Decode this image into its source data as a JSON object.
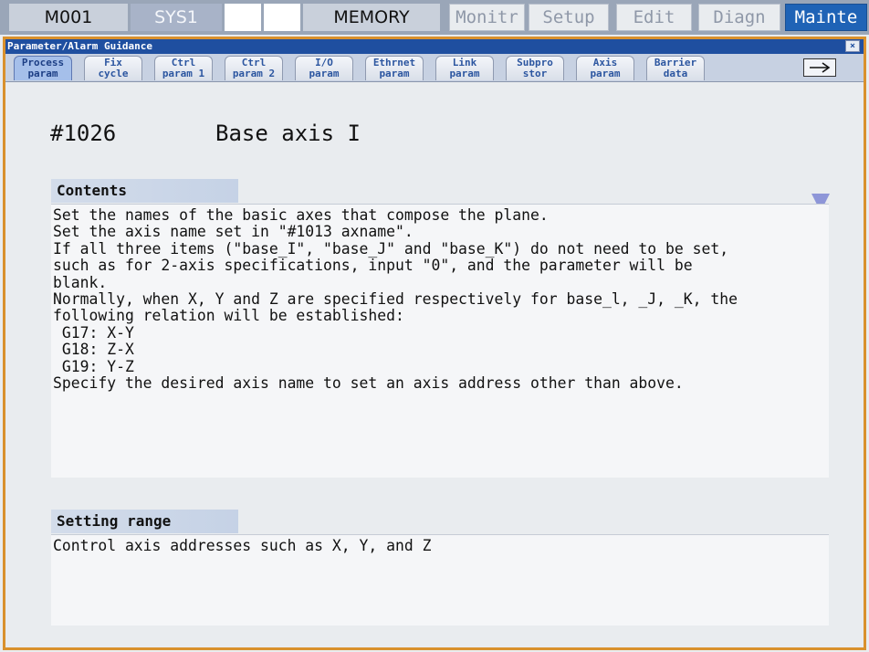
{
  "topbar": {
    "status": "M001",
    "system": "SYS1",
    "mode": "MEMORY",
    "menus": [
      "Monitr",
      "Setup",
      "Edit",
      "Diagn",
      "Mainte"
    ]
  },
  "window": {
    "title": "Parameter/Alarm Guidance",
    "close": "×"
  },
  "tabs": [
    {
      "line1": "Process",
      "line2": "param"
    },
    {
      "line1": "Fix",
      "line2": "cycle"
    },
    {
      "line1": "Ctrl",
      "line2": "param 1"
    },
    {
      "line1": "Ctrl",
      "line2": "param 2"
    },
    {
      "line1": "I/O",
      "line2": "param"
    },
    {
      "line1": "Ethrnet",
      "line2": "param"
    },
    {
      "line1": "Link",
      "line2": "param"
    },
    {
      "line1": "Subpro",
      "line2": "stor"
    },
    {
      "line1": "Axis",
      "line2": "param"
    },
    {
      "line1": "Barrier",
      "line2": "data"
    }
  ],
  "param": {
    "number": "#1026",
    "name": "Base axis I"
  },
  "contents": {
    "header": "Contents",
    "lines": [
      "Set the names of the basic axes that compose the plane.",
      "Set the axis name set in \"#1013 axname\".",
      "If all three items (\"base_I\", \"base_J\" and \"base_K\") do not need to be set,",
      "such as for 2-axis specifications, input \"0\", and the parameter will be",
      "blank.",
      "Normally, when X, Y and Z are specified respectively for base_l, _J, _K, the",
      "following relation will be established:",
      " G17: X-Y",
      " G18: Z-X",
      " G19: Y-Z",
      "Specify the desired axis name to set an axis address other than above."
    ]
  },
  "setting_range": {
    "header": "Setting range",
    "text": "Control axis addresses such as X, Y, and Z"
  },
  "colors": {
    "active_menu": "#1f63b6",
    "window_border": "#d9912d",
    "titlebar": "#1f4fa0"
  }
}
